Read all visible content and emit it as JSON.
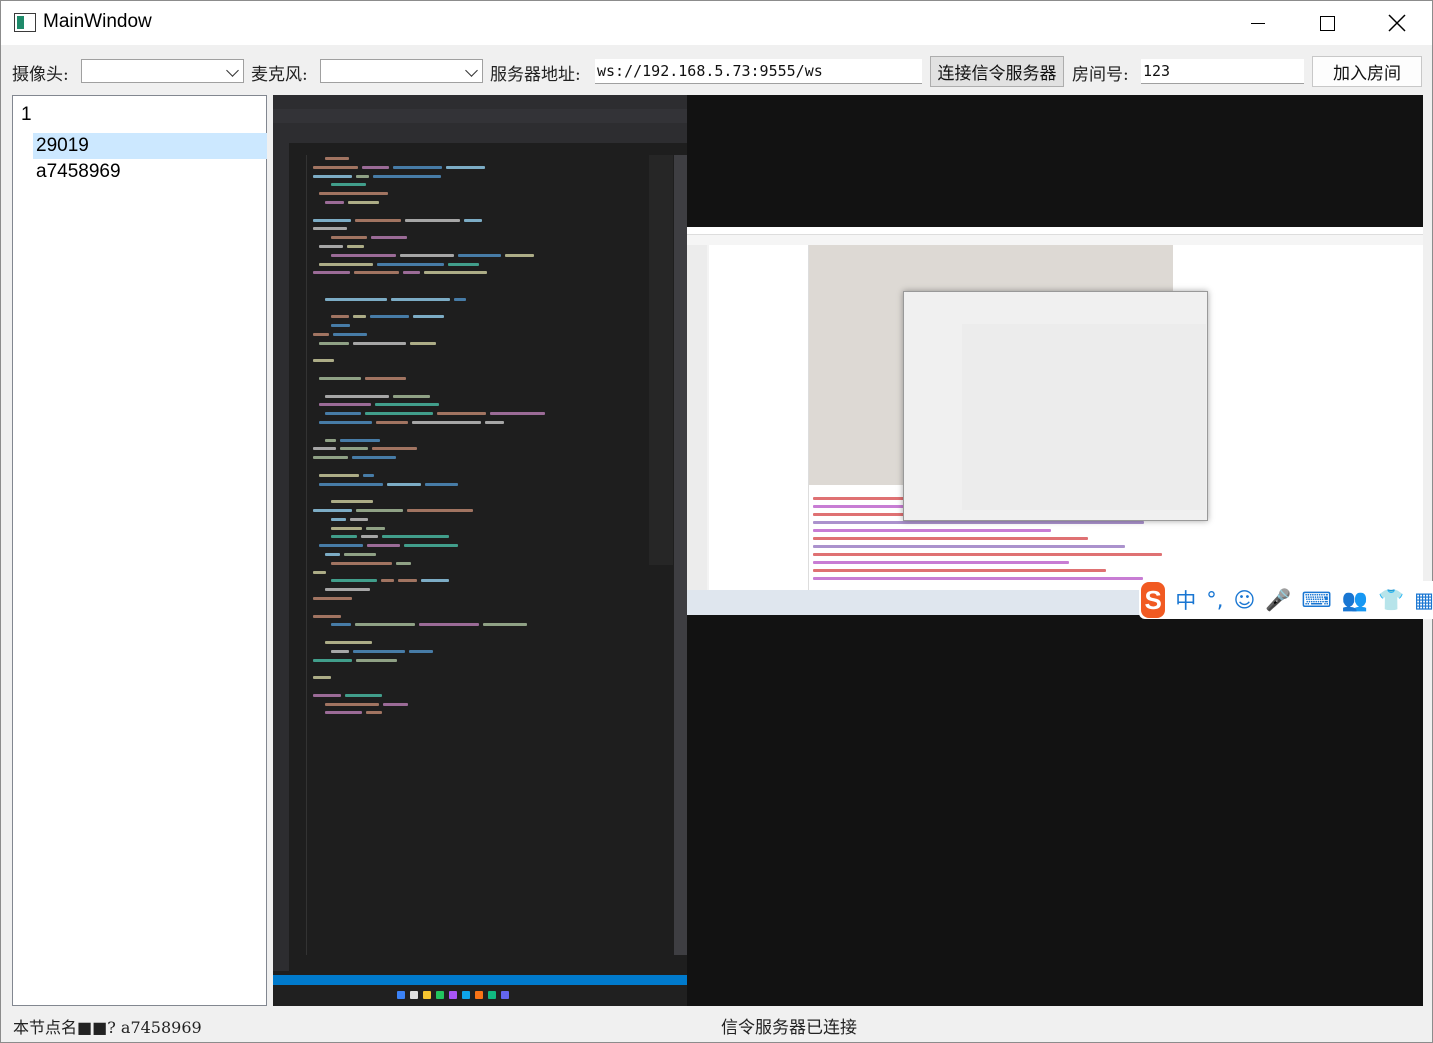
{
  "window": {
    "title": "MainWindow"
  },
  "toolbar": {
    "camera_label": "摄像头:",
    "camera_value": "",
    "mic_label": "麦克风:",
    "mic_value": "",
    "server_label": "服务器地址:",
    "server_value": "ws://192.168.5.73:9555/ws",
    "connect_label": "连接信令服务器",
    "room_label": "房间号:",
    "room_value": "123",
    "join_label": "加入房间"
  },
  "tree": {
    "root": "1",
    "children": [
      "29019",
      "a7458969"
    ],
    "selected_index": 0
  },
  "status": {
    "node_name": "本节点名■■?   a7458969",
    "signal_status": "信令服务器已连接"
  },
  "ime": {
    "logo": "S",
    "items": [
      "中",
      "°,",
      "☺",
      "🎤",
      "⌨",
      "👥",
      "👕",
      "▦"
    ]
  },
  "colors": {
    "selection": "#cce8ff",
    "ide_bg": "#1e1e1e",
    "ide_accent": "#007acc",
    "ime_accent": "#f15a22"
  }
}
